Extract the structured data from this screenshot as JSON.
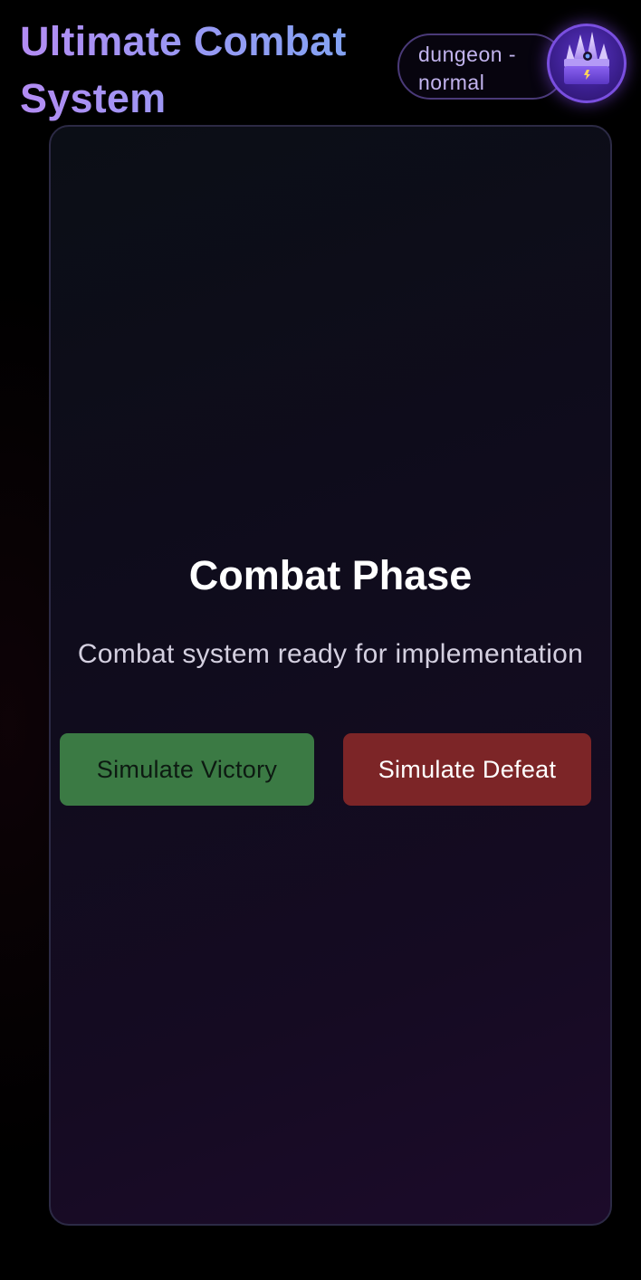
{
  "header": {
    "title": "Ultimate Combat System",
    "location_line1": "dungeon -",
    "location_line2": "normal",
    "avatar_icon": "crystal-crown-chest-icon"
  },
  "combat": {
    "title": "Combat Phase",
    "subtitle": "Combat system ready for implementation",
    "victory_label": "Simulate Victory",
    "defeat_label": "Simulate Defeat"
  },
  "colors": {
    "victory_button": "#3b7a44",
    "defeat_button": "#7c2527",
    "title_gradient_start": "#b38cf3",
    "title_gradient_end": "#7ea5f2"
  }
}
